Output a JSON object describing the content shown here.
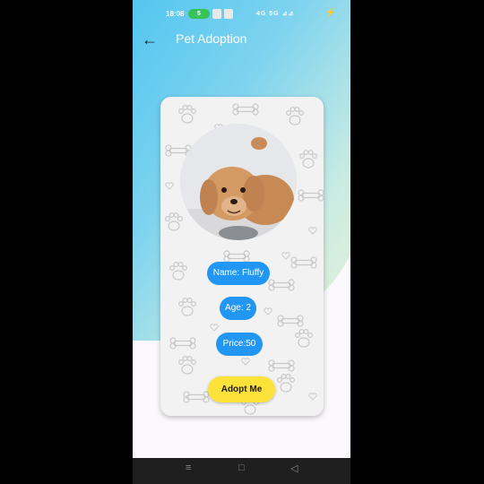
{
  "status_bar": {
    "time": "18:08",
    "pill_label": "5",
    "right_indicators": "4G  5G  ⊿⊿",
    "battery_icon": "bolt-icon"
  },
  "app_bar": {
    "back_icon": "arrow-left-icon",
    "title": "Pet Adoption"
  },
  "pet_card": {
    "name_label": "Name: Fluffy",
    "age_label": "Age: 2",
    "price_label": "Price:50",
    "adopt_button": "Adopt Me"
  },
  "nav_bar": {
    "menu_icon": "≡",
    "home_icon": "□",
    "back_icon": "◁"
  },
  "colors": {
    "accent_blue": "#2196f3",
    "adopt_yellow": "#fde23a",
    "gradient_start": "#3fc0f0",
    "gradient_end": "#eef3d6"
  }
}
